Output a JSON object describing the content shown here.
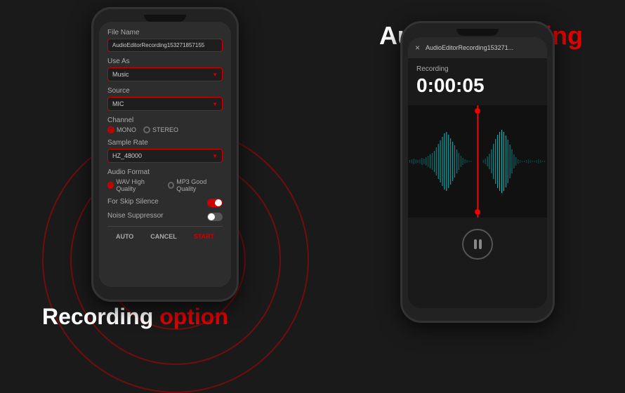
{
  "title": {
    "audio": "Audio",
    "recording_red": "Recording",
    "bottom_recording": "Recording",
    "bottom_option_red": "option"
  },
  "phone_left": {
    "sections": {
      "file_name": {
        "label": "File Name",
        "value": "AudioEditorRecording153271857155"
      },
      "use_as": {
        "label": "Use As",
        "value": "Music"
      },
      "source": {
        "label": "Source",
        "value": "MIC"
      },
      "channel": {
        "label": "Channel",
        "mono_label": "MONO",
        "stereo_label": "STEREO",
        "mono_active": true
      },
      "sample_rate": {
        "label": "Sample Rate",
        "value": "HZ_48000"
      },
      "audio_format": {
        "label": "Audio Format",
        "wav_label": "WAV High Quality",
        "mp3_label": "MP3 Good Quality",
        "wav_active": true
      },
      "skip_silence": {
        "label": "For Skip Silence",
        "enabled": true
      },
      "noise_suppressor": {
        "label": "Noise Suppressor",
        "enabled": false
      }
    },
    "buttons": {
      "auto": "AUTO",
      "cancel": "CANCEL",
      "start": "START"
    }
  },
  "phone_right": {
    "close_btn": "×",
    "filename": "AudioEditorRecording153271...",
    "recording_label": "Recording",
    "timer": "0:00:05",
    "pause_btn_label": "pause"
  }
}
